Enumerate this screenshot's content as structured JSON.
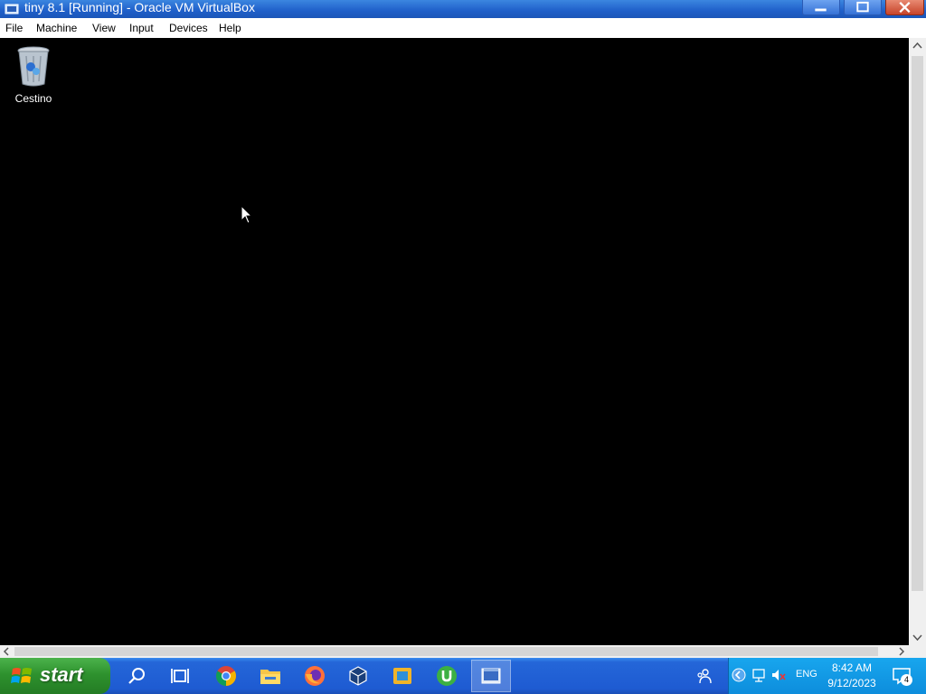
{
  "window": {
    "title": "tiny 8.1 [Running] - Oracle VM VirtualBox"
  },
  "menu": {
    "items": [
      {
        "label": "File"
      },
      {
        "label": "Machine"
      },
      {
        "label": "View"
      },
      {
        "label": "Input"
      },
      {
        "label": "Devices"
      },
      {
        "label": "Help"
      }
    ]
  },
  "desktop": {
    "icons": [
      {
        "label": "Cestino",
        "icon": "recycle-bin-icon"
      }
    ]
  },
  "taskbar": {
    "start_label": "start",
    "apps": [
      {
        "icon": "search-icon"
      },
      {
        "icon": "task-view-icon"
      },
      {
        "icon": "chrome-icon"
      },
      {
        "icon": "file-explorer-icon"
      },
      {
        "icon": "firefox-icon"
      },
      {
        "icon": "virtualbox-icon"
      },
      {
        "icon": "app-icon"
      },
      {
        "icon": "utorrent-icon"
      },
      {
        "icon": "vm-window-icon",
        "active": true
      }
    ],
    "tray": {
      "language": "ENG",
      "time": "8:42 AM",
      "date": "9/12/2023",
      "notification_count": "4"
    }
  },
  "colors": {
    "titlebar": "#1f5fc9",
    "taskbar": "#1e5bd2",
    "start_button": "#2e922e",
    "tray": "#0d8ddc",
    "desktop": "#000000"
  }
}
